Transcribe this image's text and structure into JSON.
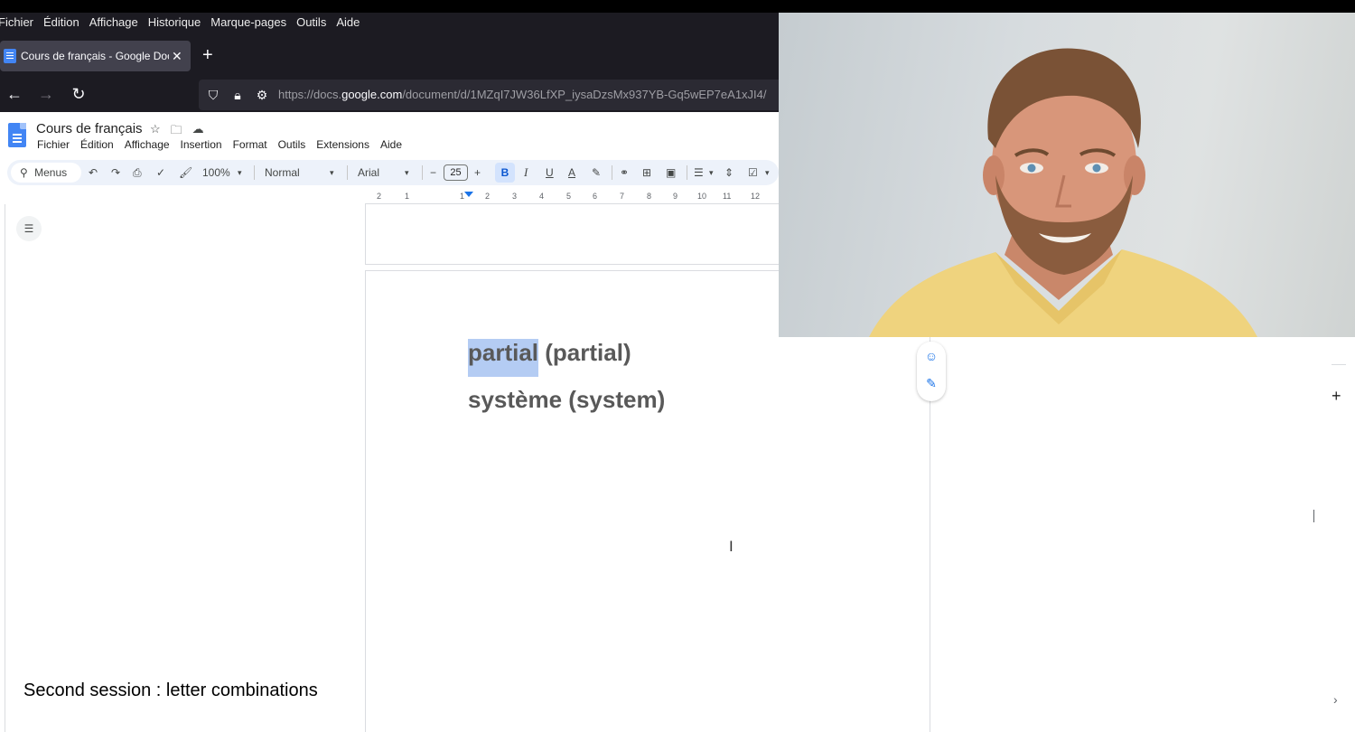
{
  "browser": {
    "menu": [
      "Fichier",
      "Édition",
      "Affichage",
      "Historique",
      "Marque-pages",
      "Outils",
      "Aide"
    ],
    "tab_title": "Cours de français - Google Doc",
    "tab_close": "✕",
    "new_tab": "+",
    "url_prefix": "https://docs.",
    "url_domain": "google.com",
    "url_path": "/document/d/1MZqI7JW36LfXP_iysaDzsMx937YB-Gq5wEP7eA1xJI4/"
  },
  "docs": {
    "title": "Cours de français",
    "menu": [
      "Fichier",
      "Édition",
      "Affichage",
      "Insertion",
      "Format",
      "Outils",
      "Extensions",
      "Aide"
    ],
    "toolbar": {
      "menus_label": "Menus",
      "zoom": "100%",
      "style": "Normal",
      "font": "Arial",
      "font_size": "25",
      "bold": "B",
      "italic": "I",
      "underline": "U",
      "text_color": "A"
    },
    "ruler_numbers": [
      "2",
      "1",
      "1",
      "2",
      "3",
      "4",
      "5",
      "6",
      "7",
      "8",
      "9",
      "10",
      "11",
      "12"
    ],
    "content": {
      "line1_highlighted": "partial",
      "line1_rest": " (partial)",
      "line2": "système (system)"
    }
  },
  "caption": "Second session : letter combinations",
  "colors": {
    "chrome_bg": "#1c1b22",
    "toolbar_bg": "#edf2fa",
    "selection": "#b4ccf3",
    "docs_blue": "#4285f4"
  }
}
